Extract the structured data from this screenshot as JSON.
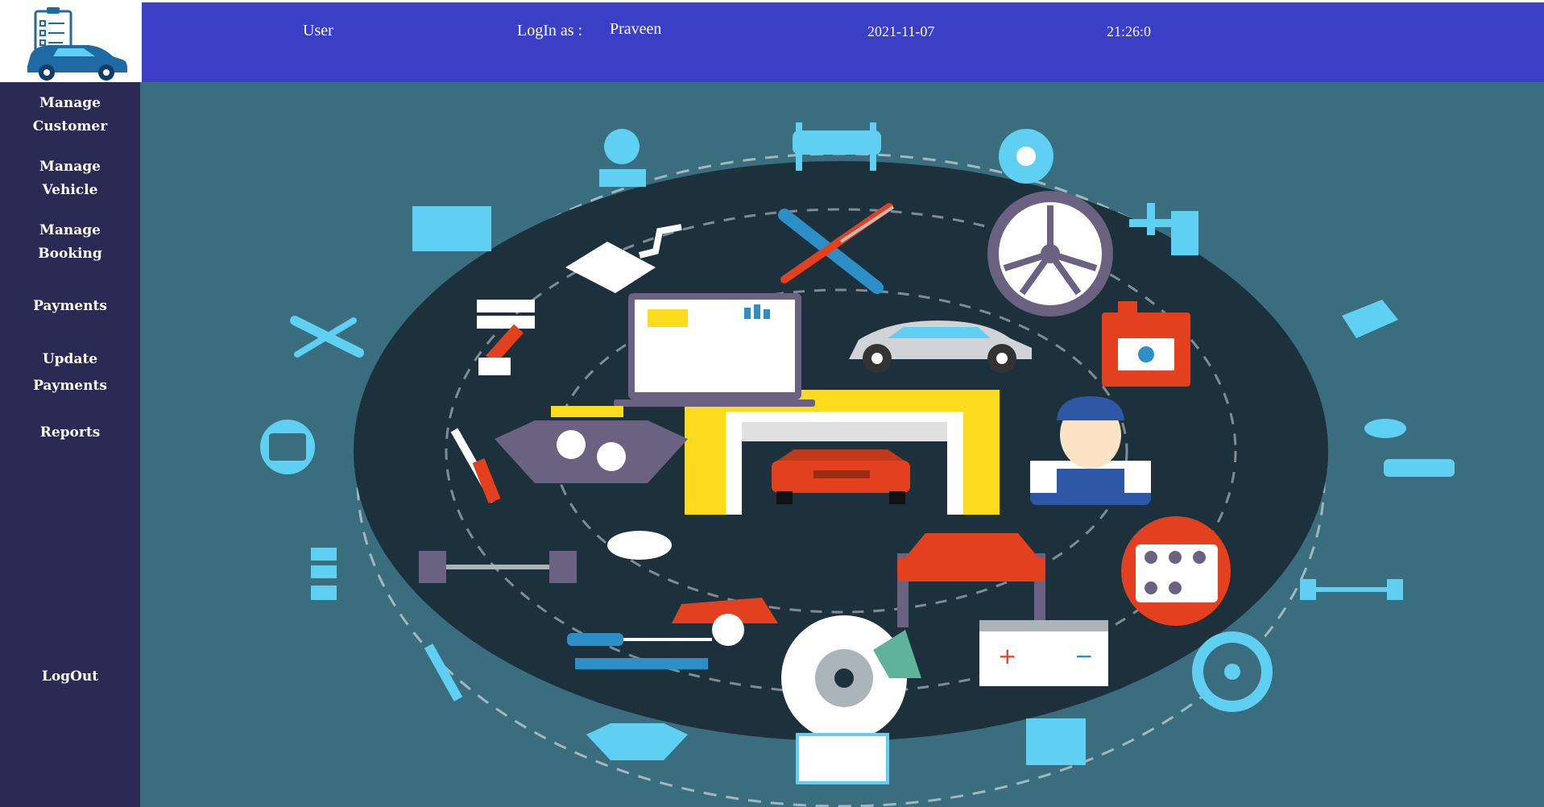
{
  "header": {
    "user_label": "User",
    "login_label": "LogIn as :",
    "login_user": "Praveen",
    "date": "2021-11-07",
    "time": "21:26:0"
  },
  "sidebar": {
    "items": [
      {
        "line1": "Manage",
        "line2": "Customer"
      },
      {
        "line1": "Manage",
        "line2": "Vehicle"
      },
      {
        "line1": "Manage",
        "line2": "Booking"
      },
      {
        "line1": "Payments",
        "line2": ""
      },
      {
        "line1": "Update",
        "line2": "Payments"
      },
      {
        "line1": "Reports",
        "line2": ""
      },
      {
        "line1": "LogOut",
        "line2": ""
      }
    ]
  },
  "graphic": {
    "icons": [
      "mechanic-icon",
      "car-lift-icon",
      "brake-disc-icon",
      "shock-absorber-icon",
      "wrench-screwdriver-icon",
      "tire-icon",
      "oil-can-icon",
      "exhaust-icon",
      "battery-icon",
      "piston-icon",
      "diagnostic-laptop-icon",
      "car-icon",
      "gearshift-icon",
      "spark-plug-icon",
      "engine-icon",
      "garage-icon",
      "axle-icon",
      "car-repair-icon",
      "wheel-icon"
    ],
    "colors": {
      "background": "#3a6d7d",
      "inner_circle": "#1c313c",
      "accent_light": "#5fd0f2",
      "accent_red": "#e2401e",
      "accent_yellow": "#fbdb1e"
    }
  }
}
